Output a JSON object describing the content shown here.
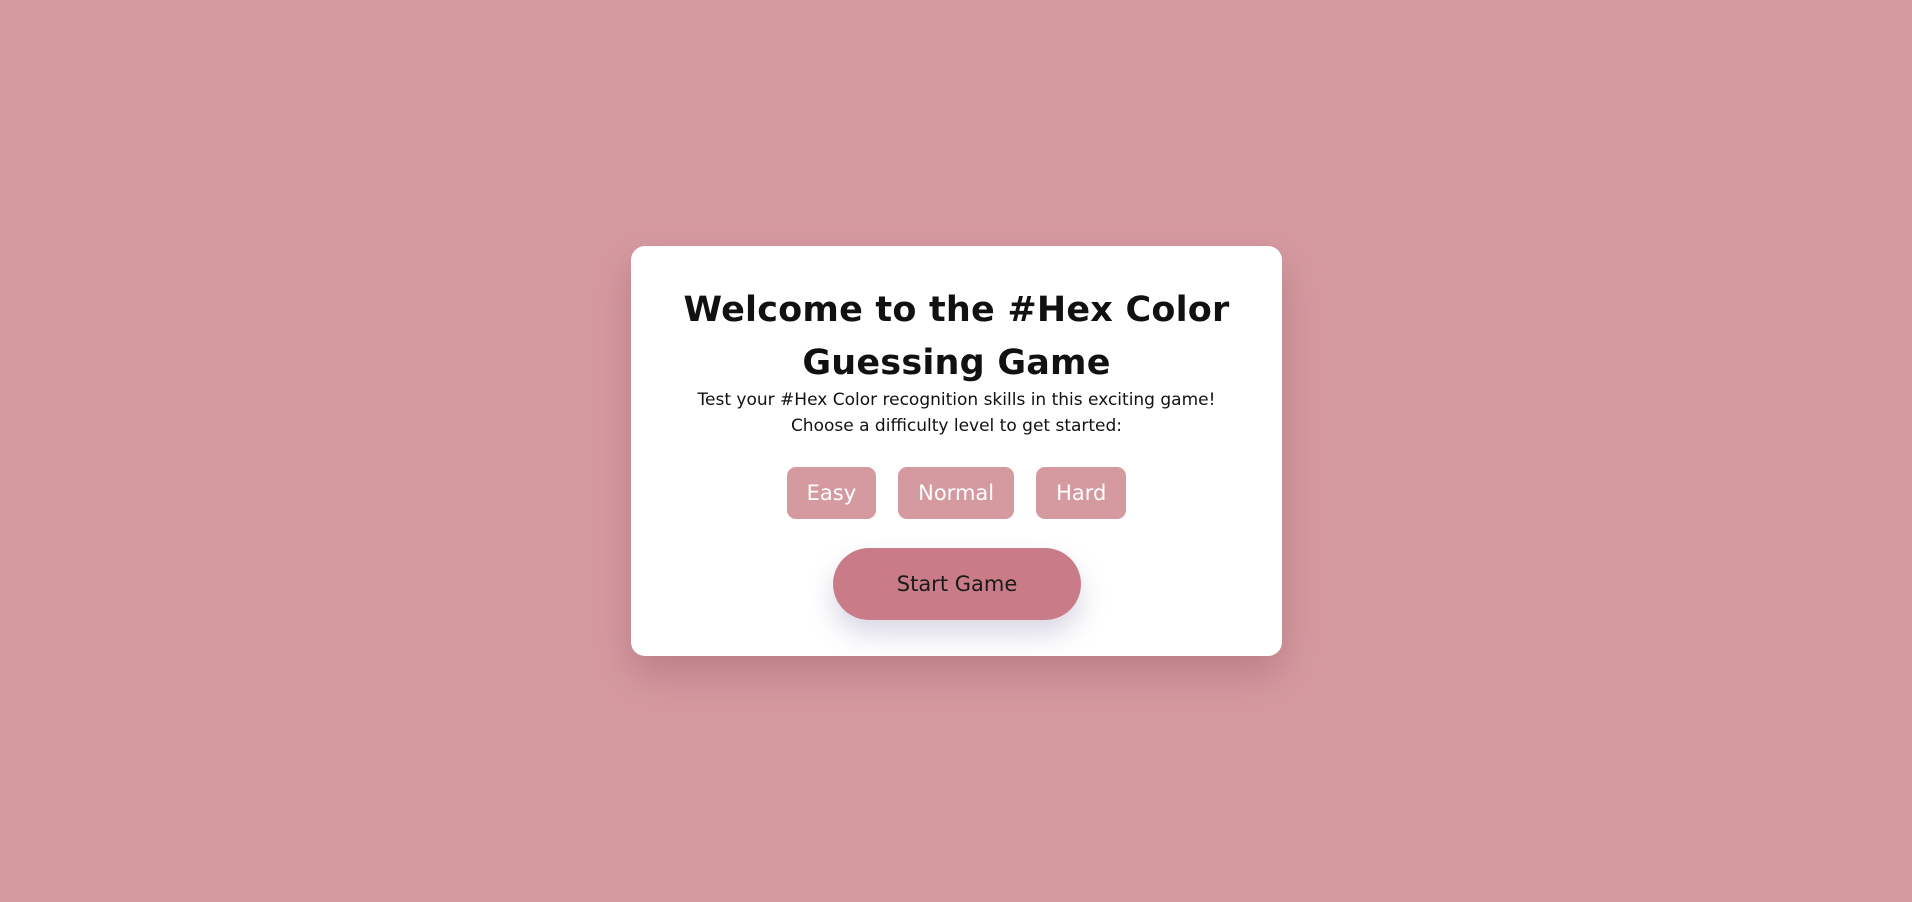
{
  "theme": {
    "background": "#d59aa0",
    "card": "#ffffff",
    "difficulty_button": "#d59aa0",
    "start_button": "#c97c87"
  },
  "welcome": {
    "title": "Welcome to the #Hex Color Guessing Game",
    "subtitle_line1": "Test your #Hex Color recognition skills in this exciting game!",
    "subtitle_line2": "Choose a difficulty level to get started:"
  },
  "difficulty": {
    "options": [
      "Easy",
      "Normal",
      "Hard"
    ]
  },
  "start": {
    "label": "Start Game"
  }
}
